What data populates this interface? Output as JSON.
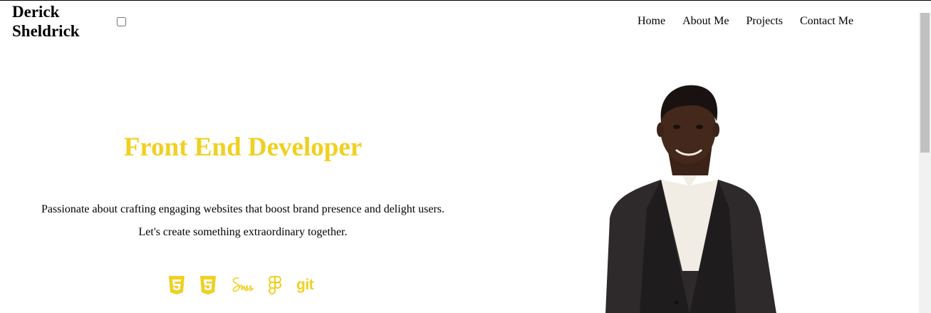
{
  "header": {
    "brand": "Derick Sheldrick",
    "nav": [
      "Home",
      "About Me",
      "Projects",
      "Contact Me"
    ]
  },
  "hero": {
    "title": "Front End Developer",
    "line1": "Passionate about crafting engaging websites that boost brand presence and delight users.",
    "line2": "Let's create something extraordinary together.",
    "skills": [
      "html5-icon",
      "css3-icon",
      "sass-icon",
      "figma-icon",
      "git-icon"
    ],
    "git_label": "git"
  },
  "colors": {
    "accent": "#f0d020",
    "text": "#000000",
    "background": "#ffffff"
  }
}
